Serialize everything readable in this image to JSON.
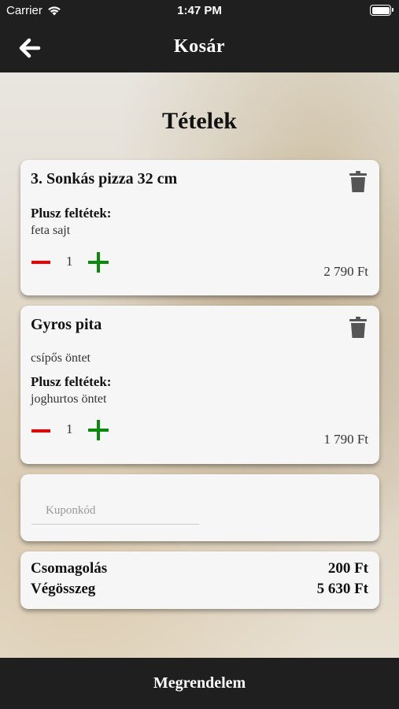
{
  "status_bar": {
    "carrier": "Carrier",
    "time": "1:47 PM"
  },
  "nav": {
    "title": "Kosár",
    "back_icon": "arrow-left-icon"
  },
  "section_title": "Tételek",
  "items": [
    {
      "name": "3. Sonkás pizza 32 cm",
      "note": "",
      "extras_label": "Plusz feltétek:",
      "extras": "feta sajt",
      "quantity": "1",
      "price": "2 790 Ft"
    },
    {
      "name": "Gyros pita",
      "note": "csípős öntet",
      "extras_label": "Plusz feltétek:",
      "extras": "joghurtos öntet",
      "quantity": "1",
      "price": "1 790 Ft"
    }
  ],
  "coupon": {
    "placeholder": "Kuponkód",
    "value": ""
  },
  "summary": {
    "packaging_label": "Csomagolás",
    "packaging_value": "200 Ft",
    "total_label": "Végösszeg",
    "total_value": "5 630 Ft"
  },
  "order_button": "Megrendelem",
  "colors": {
    "bar": "#1f1f1f",
    "minus": "#ee0000",
    "plus": "#0a8a0a",
    "card": "#f6f6f6"
  }
}
